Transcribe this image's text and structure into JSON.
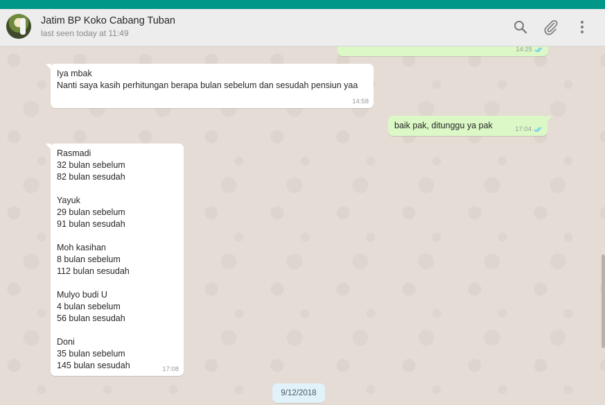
{
  "header": {
    "contact_name": "Jatim BP Koko Cabang Tuban",
    "last_seen": "last seen today at 11:49",
    "icons": [
      "search-icon",
      "attach-icon",
      "menu-icon"
    ]
  },
  "messages": [
    {
      "direction": "out",
      "text": "",
      "time": "14:25",
      "ticks": "read"
    },
    {
      "direction": "in",
      "text": "Iya mbak\nNanti saya kasih perhitungan berapa bulan sebelum dan sesudah pensiun yaa",
      "time": "14:58"
    },
    {
      "direction": "out",
      "text": "baik pak, ditunggu ya pak",
      "time": "17:04",
      "ticks": "read"
    },
    {
      "direction": "in",
      "text": "Rasmadi\n32 bulan sebelum\n82 bulan sesudah\n\nYayuk\n29 bulan sebelum\n91 bulan sesudah\n\nMoh kasihan\n8 bulan sebelum\n112 bulan sesudah\n\nMulyo budi U\n4 bulan sebelum\n56 bulan sesudah\n\nDoni\n35 bulan sebelum\n145 bulan sesudah",
      "time": "17:08"
    }
  ],
  "date_divider": "9/12/2018",
  "colors": {
    "accent": "#009688",
    "incoming_bubble": "#ffffff",
    "outgoing_bubble": "#dcf8c6",
    "read_ticks": "#4fc3f7",
    "date_chip": "#e1f2fb"
  }
}
